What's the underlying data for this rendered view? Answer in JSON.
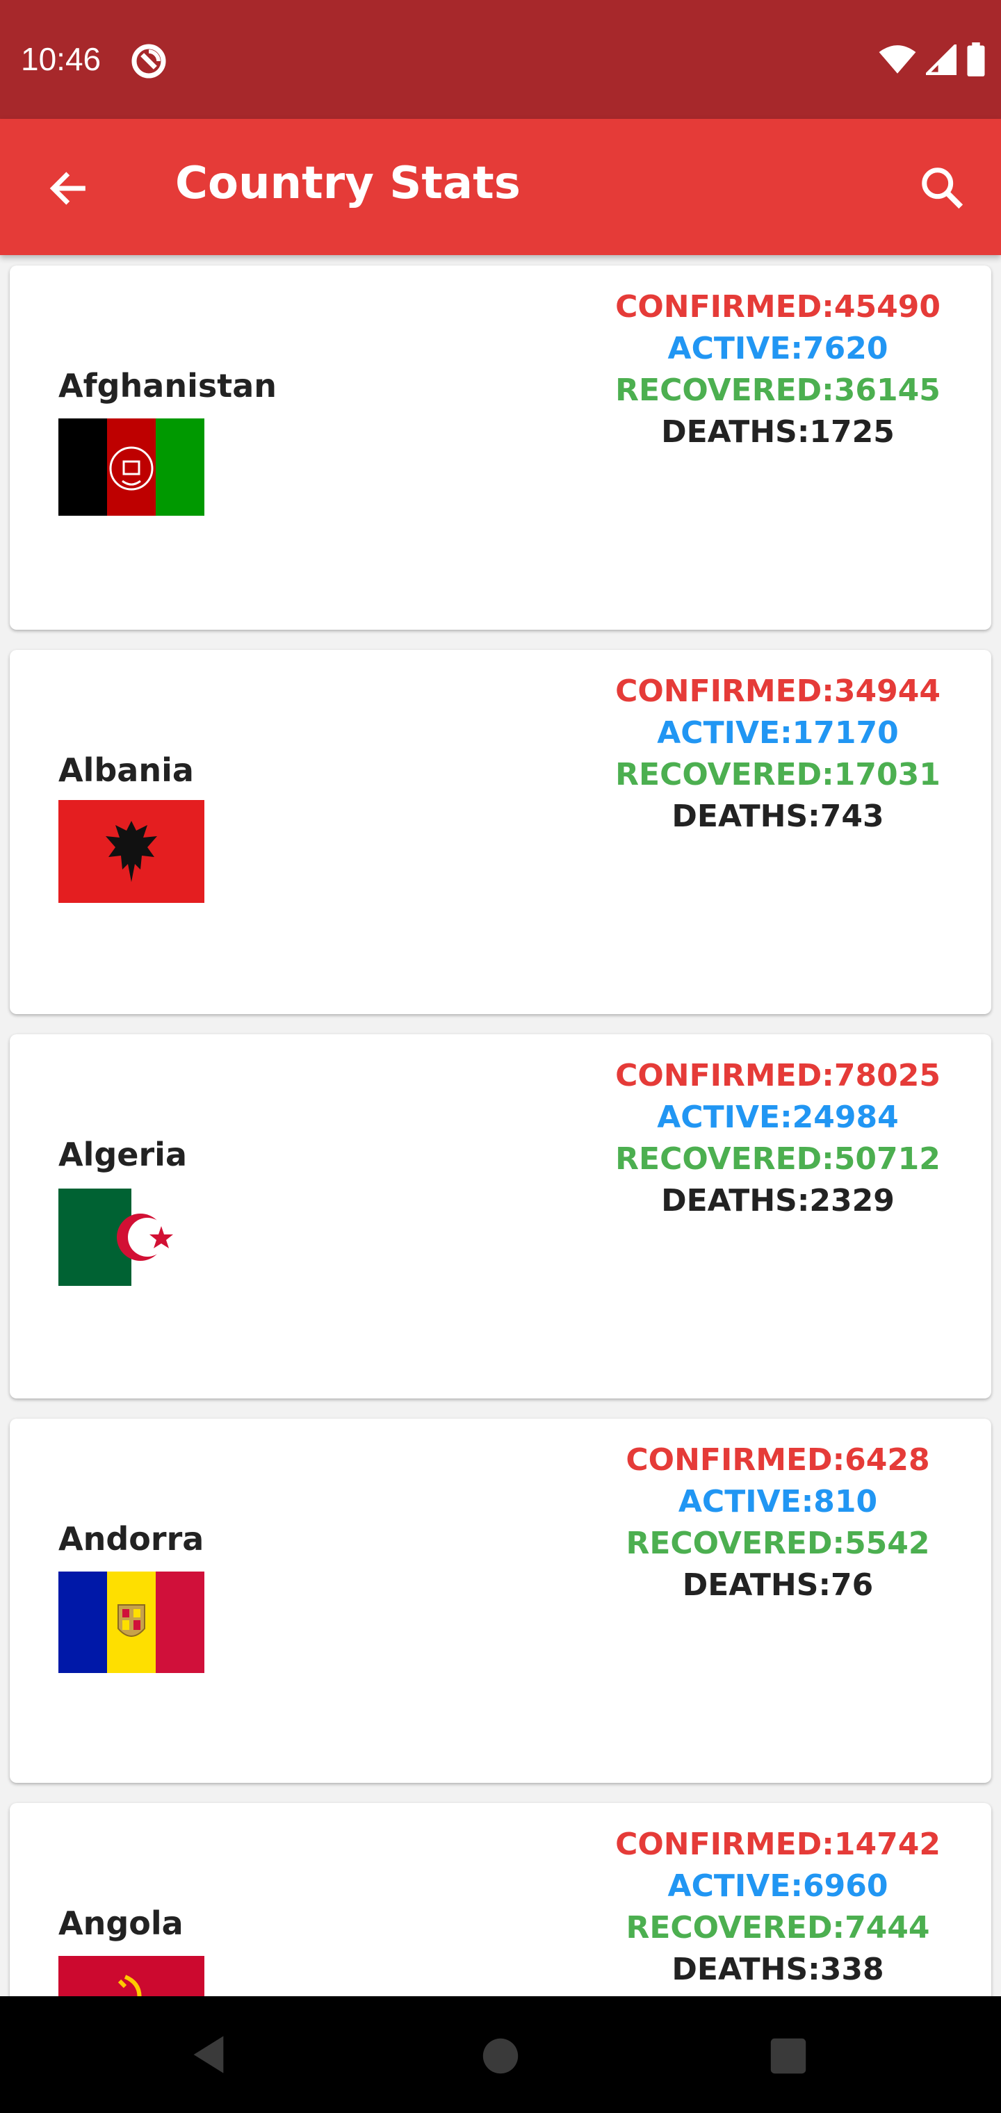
{
  "status_bar": {
    "time": "10:46"
  },
  "app_bar": {
    "title": "Country Stats",
    "back_icon": "arrow-back-icon",
    "search_icon": "search-icon"
  },
  "countries": [
    {
      "name": "Afghanistan",
      "confirmed": "CONFIRMED:45490",
      "active": "ACTIVE:7620",
      "recovered": "RECOVERED:36145",
      "deaths": "DEATHS:1725"
    },
    {
      "name": "Albania",
      "confirmed": "CONFIRMED:34944",
      "active": "ACTIVE:17170",
      "recovered": "RECOVERED:17031",
      "deaths": "DEATHS:743"
    },
    {
      "name": "Algeria",
      "confirmed": "CONFIRMED:78025",
      "active": "ACTIVE:24984",
      "recovered": "RECOVERED:50712",
      "deaths": "DEATHS:2329"
    },
    {
      "name": "Andorra",
      "confirmed": "CONFIRMED:6428",
      "active": "ACTIVE:810",
      "recovered": "RECOVERED:5542",
      "deaths": "DEATHS:76"
    },
    {
      "name": "Angola",
      "confirmed": "CONFIRMED:14742",
      "active": "ACTIVE:6960",
      "recovered": "RECOVERED:7444",
      "deaths": "DEATHS:338"
    }
  ],
  "colors": {
    "status_bar": "#a7282b",
    "app_bar": "#e53b38",
    "confirmed": "#e53b38",
    "active": "#2196f3",
    "recovered": "#4caf50",
    "deaths": "#222222"
  }
}
